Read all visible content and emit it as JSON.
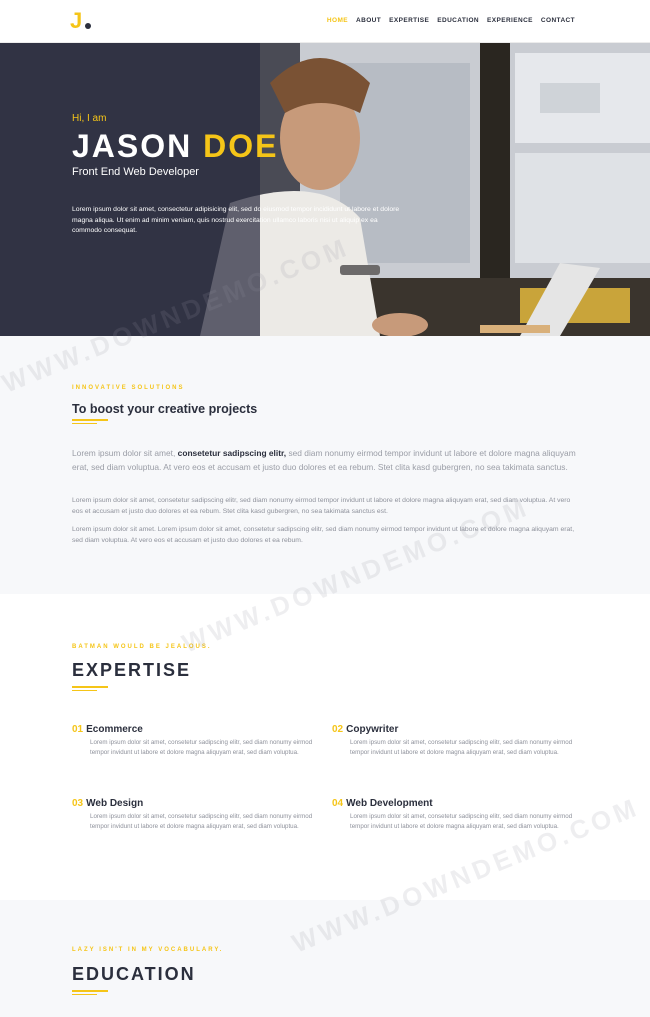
{
  "nav": {
    "logo_letter": "J",
    "items": [
      {
        "label": "HOME",
        "active": true
      },
      {
        "label": "ABOUT",
        "active": false
      },
      {
        "label": "EXPERTISE",
        "active": false
      },
      {
        "label": "EDUCATION",
        "active": false
      },
      {
        "label": "EXPERIENCE",
        "active": false
      },
      {
        "label": "CONTACT",
        "active": false
      }
    ]
  },
  "hero": {
    "greeting": "Hi, I am",
    "first_name": "JASON",
    "last_name": "DOE",
    "role": "Front End Web Developer",
    "description": "Lorem ipsum dolor sit amet, consectetur adipisicing elit, sed do eiusmod tempor incididunt ut labore et dolore magna aliqua. Ut enim ad minim veniam, quis nostrud exercitation ullamco laboris nisi ut aliquip ex ea commodo consequat."
  },
  "about": {
    "kicker": "INNOVATIVE SOLUTIONS",
    "title": "To boost your creative projects",
    "lead_start": "Lorem ipsum dolor sit amet, ",
    "lead_bold": "consetetur sadipscing elitr,",
    "lead_end": " sed diam nonumy eirmod tempor invidunt ut labore et dolore magna aliquyam erat, sed diam voluptua. At vero eos et accusam et justo duo dolores et ea rebum. Stet clita kasd gubergren, no sea takimata sanctus.",
    "paragraph1": "Lorem ipsum dolor sit amet, consetetur sadipscing elitr, sed diam nonumy eirmod tempor invidunt ut labore et dolore magna aliquyam erat, sed diam voluptua. At vero eos et accusam et justo duo dolores et ea rebum. Stet clita kasd gubergren, no sea takimata sanctus est.",
    "paragraph2": "Lorem ipsum dolor sit amet. Lorem ipsum dolor sit amet, consetetur sadipscing elitr, sed diam nonumy eirmod tempor invidunt ut labore et dolore magna aliquyam erat, sed diam voluptua. At vero eos et accusam et justo duo dolores et ea rebum."
  },
  "expertise": {
    "kicker": "BATMAN WOULD BE JEALOUS.",
    "title": "EXPERTISE",
    "items": [
      {
        "num": "01",
        "name": "Ecommerce",
        "text": "Lorem ipsum dolor sit amet, consetetur sadipscing elitr, sed diam nonumy eirmod tempor invidunt ut labore et dolore magna aliquyam erat, sed diam voluptua."
      },
      {
        "num": "02",
        "name": "Copywriter",
        "text": "Lorem ipsum dolor sit amet, consetetur sadipscing elitr, sed diam nonumy eirmod tempor invidunt ut labore et dolore magna aliquyam erat, sed diam voluptua."
      },
      {
        "num": "03",
        "name": "Web Design",
        "text": "Lorem ipsum dolor sit amet, consetetur sadipscing elitr, sed diam nonumy eirmod tempor invidunt ut labore et dolore magna aliquyam erat, sed diam voluptua."
      },
      {
        "num": "04",
        "name": "Web Development",
        "text": "Lorem ipsum dolor sit amet, consetetur sadipscing elitr, sed diam nonumy eirmod tempor invidunt ut labore et dolore magna aliquyam erat, sed diam voluptua."
      }
    ]
  },
  "education": {
    "kicker": "LAZY ISN'T IN MY VOCABULARY.",
    "title": "EDUCATION"
  },
  "watermark": "WWW.DOWNDEMO.COM",
  "colors": {
    "accent": "#f5c518",
    "dark": "#2b2f3d",
    "section_bg": "#f7f8fa"
  }
}
